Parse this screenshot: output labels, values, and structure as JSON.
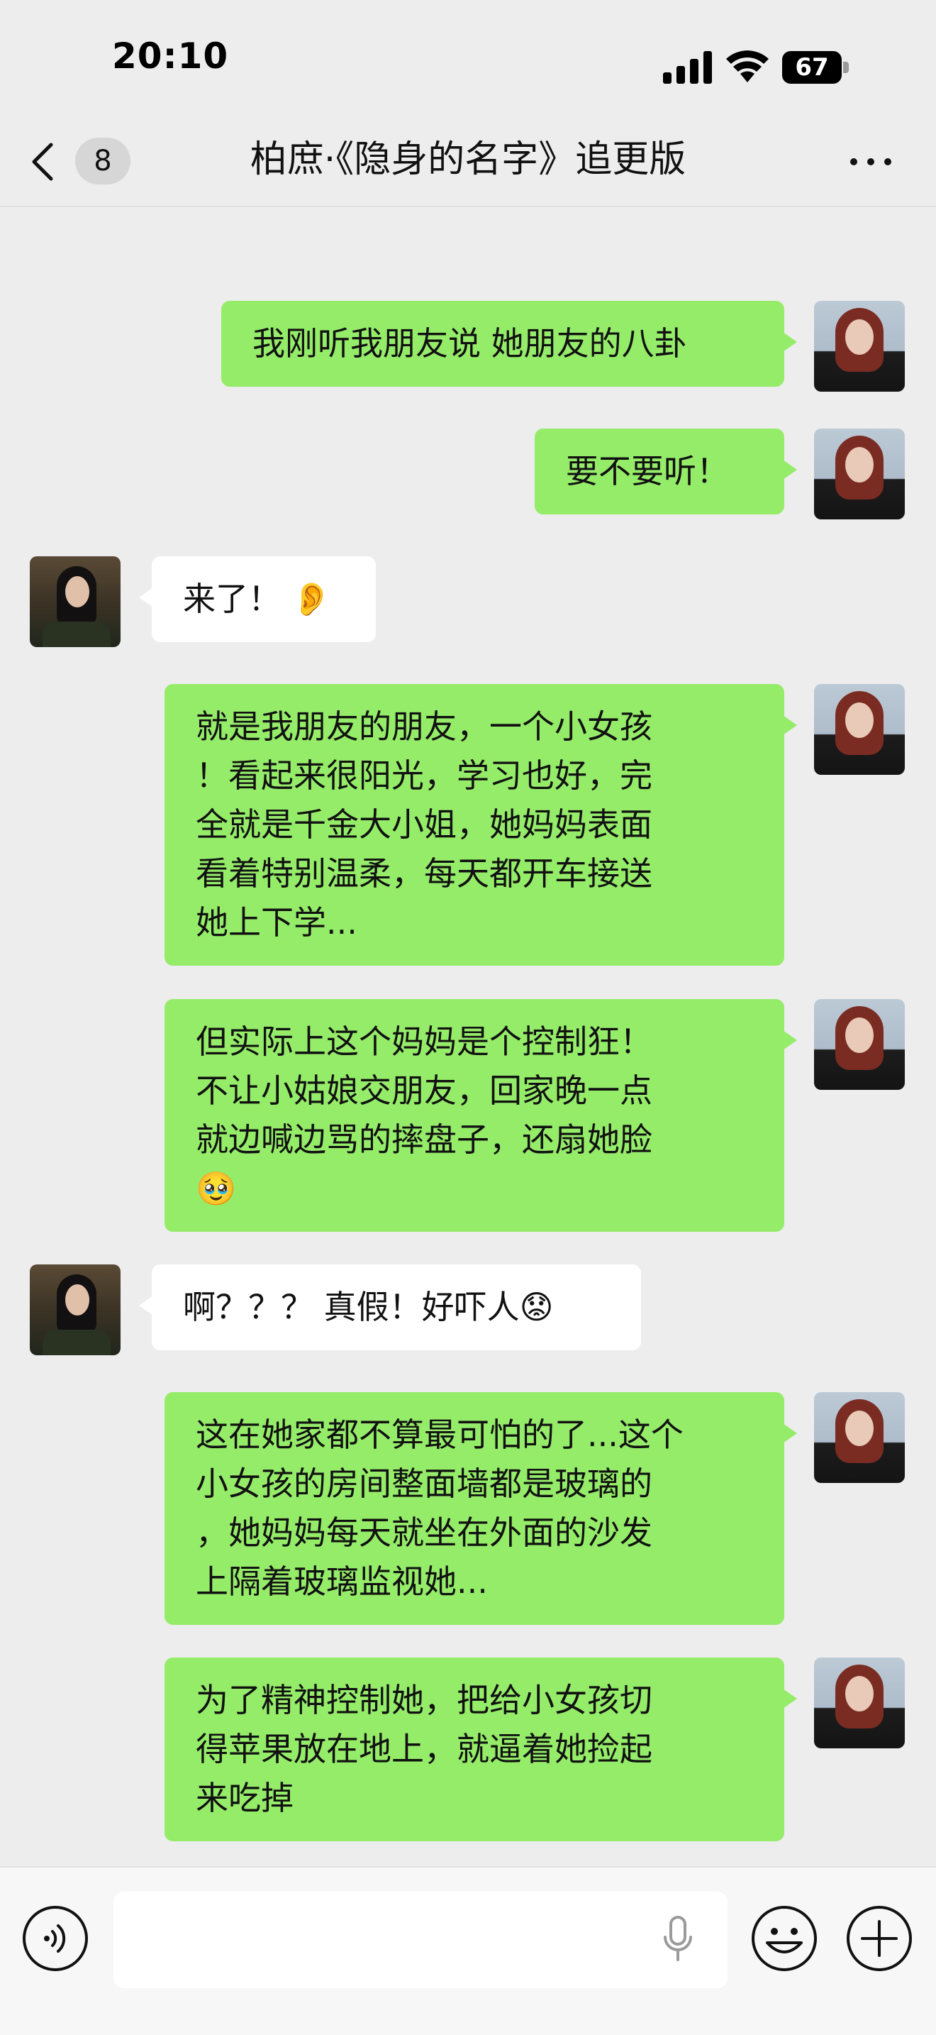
{
  "status_bar": {
    "time": "20:10",
    "battery": "67",
    "icons": [
      "signal-icon",
      "wifi-icon",
      "battery-icon"
    ]
  },
  "nav": {
    "unread_count": "8",
    "title": "柏庶·《隐身的名字》追更版",
    "icons": [
      "back-icon",
      "more-icon"
    ]
  },
  "messages": [
    {
      "sender": "me",
      "text": "我刚听我朋友说 她朋友的八卦"
    },
    {
      "sender": "me",
      "text": "要不要听！"
    },
    {
      "sender": "other",
      "text": "来了！ 👂"
    },
    {
      "sender": "me",
      "text": "就是我朋友的朋友，一个小女孩\n！看起来很阳光，学习也好，完\n全就是千金大小姐，她妈妈表面\n看着特别温柔，每天都开车接送\n她上下学..."
    },
    {
      "sender": "me",
      "text": "但实际上这个妈妈是个控制狂！\n不让小姑娘交朋友，回家晚一点\n就边喊边骂的摔盘子，还扇她脸\n🥹"
    },
    {
      "sender": "other",
      "text": "啊？？？ 真假！好吓人😟"
    },
    {
      "sender": "me",
      "text": "这在她家都不算最可怕的了...这个\n小女孩的房间整面墙都是玻璃的\n，她妈妈每天就坐在外面的沙发\n上隔着玻璃监视她..."
    },
    {
      "sender": "me",
      "text": "为了精神控制她，把给小女孩切\n得苹果放在地上，就逼着她捡起\n来吃掉"
    }
  ],
  "input_bar": {
    "icons": [
      "voice-icon",
      "mic-icon",
      "emoji-icon",
      "plus-icon"
    ]
  },
  "colors": {
    "background": "#ededed",
    "my_bubble": "#95ec69",
    "other_bubble": "#ffffff",
    "input_bar": "#f7f7f7"
  }
}
